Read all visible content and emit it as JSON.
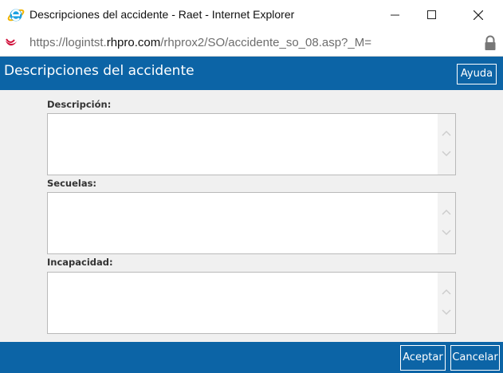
{
  "window": {
    "title": "Descripciones del accidente - Raet - Internet Explorer",
    "icon": "internet-explorer-icon",
    "controls": [
      "minimize",
      "maximize",
      "close"
    ]
  },
  "address_bar": {
    "url_prefix": "https://logintst.",
    "url_host": "rhpro.com",
    "url_path": "/rhprox2/SO/accidente_so_08.asp?_M=",
    "lock_icon": "lock-icon"
  },
  "header": {
    "title": "Descripciones del accidente",
    "help_label": "Ayuda",
    "color": "#0c64a6"
  },
  "fields": [
    {
      "label": "Descripción:",
      "value": ""
    },
    {
      "label": "Secuelas:",
      "value": ""
    },
    {
      "label": "Incapacidad:",
      "value": ""
    }
  ],
  "footer": {
    "accept_label": "Aceptar",
    "cancel_label": "Cancelar"
  },
  "colors": {
    "accent": "#0c64a6",
    "content_bg": "#f0f0f0"
  }
}
